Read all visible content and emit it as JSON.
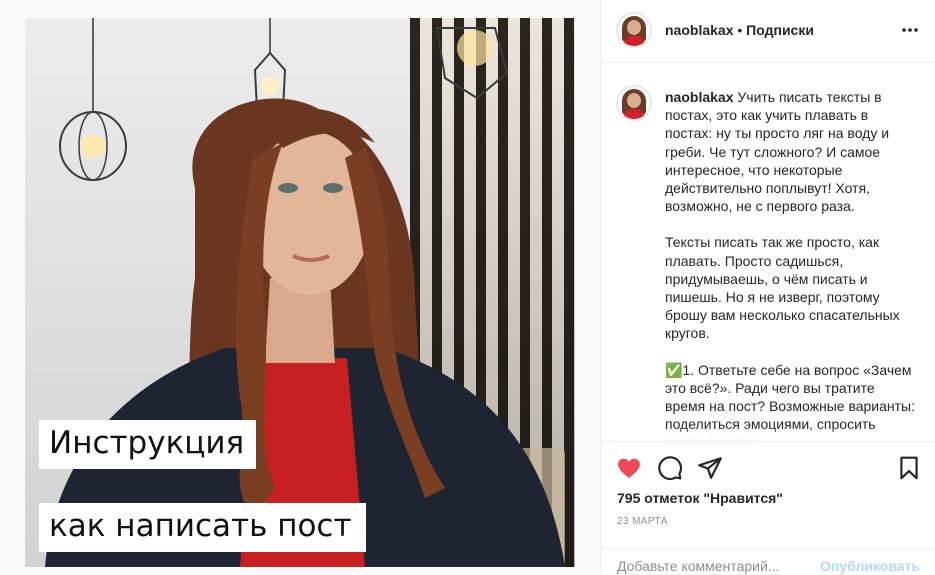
{
  "photo": {
    "caption_line1": "Инструкция",
    "caption_line2": "как написать пост"
  },
  "header": {
    "username": "naoblakax",
    "separator": " • ",
    "follow_label": "Подписки",
    "more_icon": "more-horizontal-icon"
  },
  "post": {
    "username": "naoblakax",
    "paragraph1": "Учить писать тексты в постах, это как учить плавать в постах: ну ты просто ляг на воду и греби. Че тут сложного? И самое интересное, что некоторые действительно поплывут! Хотя, возможно, не с первого раза.",
    "paragraph2": "Тексты писать так же просто, как плавать. Просто садишься, придумываешь, о чём писать и пишешь. Но я не изверг, поэтому брошу вам несколько спасательных кругов.",
    "paragraph3": "✅1. Ответьте себе на вопрос «Зачем это всё?». Ради чего вы тратите время на пост? Возможные варианты: поделиться эмоциями, спросить совет, продать."
  },
  "actions": {
    "heart_icon": "heart-icon",
    "comment_icon": "comment-icon",
    "share_icon": "share-icon",
    "bookmark_icon": "bookmark-icon",
    "likes_text": "795 отметок \"Нравится\"",
    "date": "23 марта"
  },
  "comment_box": {
    "placeholder": "Добавьте комментарий...",
    "publish_label": "Опубликовать"
  },
  "colors": {
    "heart": "#ed4956",
    "publish_disabled": "#b3dbff",
    "muted": "#8e8e8e"
  }
}
